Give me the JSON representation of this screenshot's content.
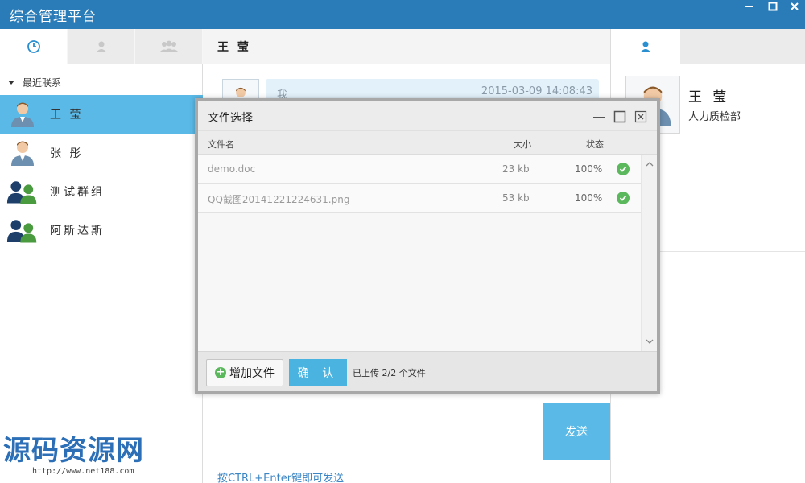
{
  "app": {
    "title": "综合管理平台"
  },
  "left": {
    "tabs": [
      {
        "icon": "clock-icon",
        "active": true
      },
      {
        "icon": "user-icon",
        "active": false
      },
      {
        "icon": "users-group-icon",
        "active": false
      }
    ],
    "group_label": "最近联系",
    "contacts": [
      {
        "name": "王 莹",
        "icon": "person-avatar",
        "active": true
      },
      {
        "name": "张 彤",
        "icon": "person-avatar",
        "active": false
      },
      {
        "name": "测试群组",
        "icon": "group-avatar",
        "active": false
      },
      {
        "name": "阿斯达斯",
        "icon": "group-avatar",
        "active": false
      }
    ]
  },
  "chat": {
    "contact_name": "王 莹",
    "messages": [
      {
        "sender": "我",
        "time": "2015-03-09 14:08:43"
      }
    ],
    "send_label": "发送",
    "hint": "按CTRL+Enter键即可发送"
  },
  "profile": {
    "tab_icon": "user-icon",
    "name": "王 莹",
    "department": "人力质检部"
  },
  "dialog": {
    "title": "文件选择",
    "columns": {
      "name": "文件名",
      "size": "大小",
      "status": "状态"
    },
    "files": [
      {
        "name": "demo.doc",
        "size": "23 kb",
        "progress": "100%"
      },
      {
        "name": "QQ截图20141221224631.png",
        "size": "53 kb",
        "progress": "100%"
      }
    ],
    "add_label": "增加文件",
    "confirm_label": "确 认",
    "upload_status": "已上传 2/2 个文件"
  },
  "watermark": {
    "text": "源码资源网",
    "url": "http://www.net188.com"
  },
  "colors": {
    "titlebar": "#2a7cb8",
    "accent": "#5ab9e6",
    "success": "#5cb85c"
  }
}
